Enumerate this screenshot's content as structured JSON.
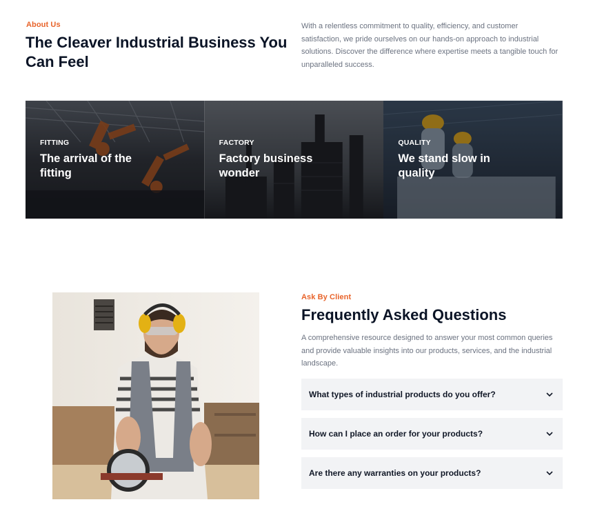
{
  "about": {
    "eyebrow": "About Us",
    "title": "The Cleaver Industrial Business You Can Feel",
    "description": "With a relentless commitment to quality, efficiency, and customer satisfaction, we pride ourselves on our hands-on approach to industrial solutions. Discover the difference where expertise meets a tangible touch for unparalleled success."
  },
  "cards": [
    {
      "tag": "FITTING",
      "title": "The arrival of the fitting",
      "image": "robotic-arms-factory"
    },
    {
      "tag": "FACTORY",
      "title": "Factory business wonder",
      "image": "refinery-plant"
    },
    {
      "tag": "QUALITY",
      "title": "We stand slow in quality",
      "image": "workers-in-hardhats"
    }
  ],
  "faq": {
    "eyebrow": "Ask By Client",
    "title": "Frequently Asked Questions",
    "description": "A comprehensive resource designed to answer your most common queries and provide valuable insights into our products, services, and the industrial landscape.",
    "image": "worker-with-circular-saw",
    "items": [
      {
        "question": "What types of industrial products do you offer?",
        "icon": "chevron-down-icon"
      },
      {
        "question": "How can I place an order for your products?",
        "icon": "chevron-down-icon"
      },
      {
        "question": "Are there any warranties on your products?",
        "icon": "chevron-down-icon"
      }
    ]
  },
  "colors": {
    "accent": "#e8632a",
    "heading": "#0b1426",
    "body": "#6b7280",
    "faq_bg": "#f2f3f5"
  }
}
